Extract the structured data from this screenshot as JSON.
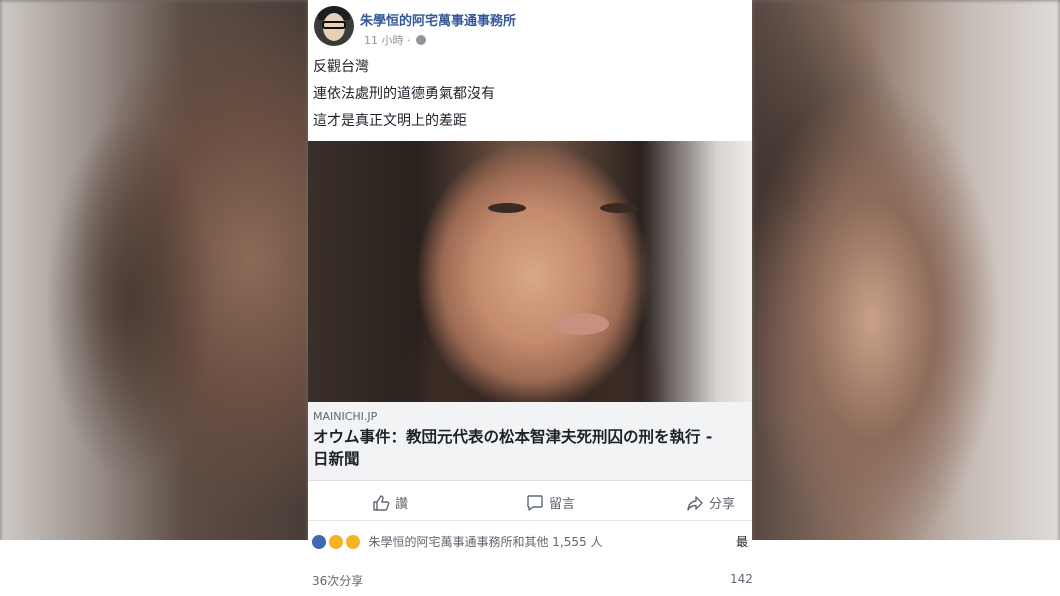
{
  "post": {
    "author": "朱學恒的阿宅萬事通事務所",
    "time": "11 小時 ·",
    "body_lines": [
      "反觀台灣",
      "連依法處刑的道德勇氣都沒有",
      "這才是真正文明上的差距"
    ],
    "link": {
      "domain": "MAINICHI.JP",
      "headline_line1": "オウム事件：教団元代表の松本智津夫死刑囚の刑を執行 -",
      "headline_line2": "日新聞"
    },
    "actions": {
      "like": "讚",
      "comment": "留言",
      "share": "分享"
    },
    "reactions": {
      "icons": [
        "like-reaction-icon",
        "haha-reaction-icon",
        "sad-reaction-icon"
      ],
      "summary": "朱學恒的阿宅萬事通事務所和其他 1,555 人",
      "sort": "最"
    },
    "shares": "36次分享",
    "comments_count": "142"
  },
  "colors": {
    "author_link": "#365899",
    "meta_gray": "#90949c",
    "link_box_bg": "#f2f3f5",
    "like_blue": "#4267b2"
  }
}
